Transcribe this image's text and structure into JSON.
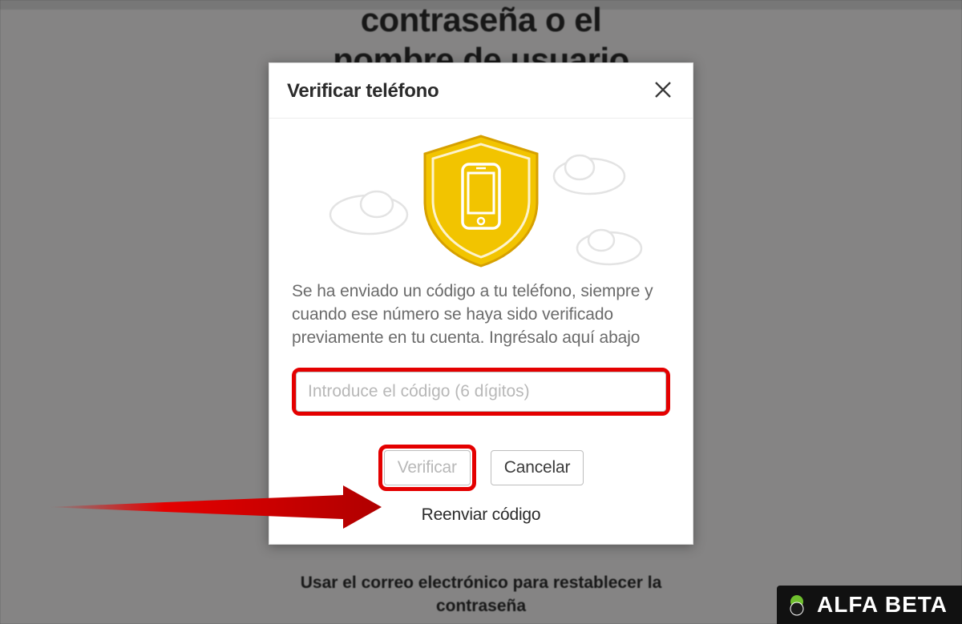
{
  "background": {
    "title_line1": "contraseña o el",
    "title_line2": "nombre de usuario",
    "email_reset_text": "Usar el correo electrónico para restablecer la contraseña"
  },
  "modal": {
    "title": "Verificar teléfono",
    "instruction": "Se ha enviado un código a tu teléfono, siempre y cuando ese número se haya sido verificado previamente en tu cuenta. Ingrésalo aquí abajo",
    "input_placeholder": "Introduce el código (6 dígitos)",
    "verify_label": "Verificar",
    "cancel_label": "Cancelar",
    "resend_label": "Reenviar código"
  },
  "watermark": {
    "text": "ALFA BETA"
  },
  "annotations": {
    "input_highlighted": true,
    "verify_highlighted": true,
    "arrow_points_to": "verify-button"
  }
}
